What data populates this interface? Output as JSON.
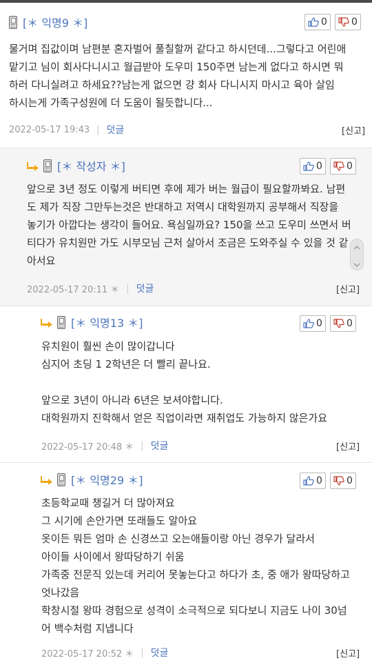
{
  "comments": [
    {
      "author": "[＊ 익명9 ＊]",
      "likes": "0",
      "dislikes": "0",
      "text": "물거며 집값이며 남편분 혼자벌어 풀칠할꺼 같다고 하시던데...그렇다고 어린애\n맡기고 님이 회사다니시고 월급받아 도우미 150주면 남는게 없다고 하시면 뭐\n하러 다니실려고 하세요??남는게 없으면 걍 회사 다니시지 마시고 육아 살임\n하시는게 가족구성원에 더 도움이 될듯합니다...",
      "date": "2022-05-17 19:43",
      "reply_label": "덧글",
      "report_label": "[신고]"
    },
    {
      "author": "[＊ 작성자 ＊]",
      "likes": "0",
      "dislikes": "0",
      "text": "앞으로 3년 정도 이렇게 버티면 후에 제가 버는 월급이 필요할까봐요. 남편\n도 제가 직장 그만두는것은 반대하고 저역시 대학원까지 공부해서 직장을\n놓기가 아깝다는 생각이 들어요. 욕심일까요? 150을 쓰고 도우미 쓰면서 버\n티다가 유치원만 가도 시부모님 근처 살아서 조금은 도와주실 수 있을 것 같\n아서요",
      "date": "2022-05-17 20:11 ＊",
      "reply_label": "덧글",
      "report_label": "[신고]"
    },
    {
      "author": "[＊ 익명13 ＊]",
      "likes": "0",
      "dislikes": "0",
      "text": "유치원이 훨씬 손이 많이갑니다\n심지어 초딩 1 2학년은 더 빨리 끝나요.\n\n앞으로 3년이 아니라 6년은 보셔야합니다.\n대학원까지 진학해서 얻은 직업이라면 재취업도 가능하지 않은가요",
      "date": "2022-05-17 20:48 ＊",
      "reply_label": "덧글",
      "report_label": "[신고]"
    },
    {
      "author": "[＊ 익명29 ＊]",
      "likes": "0",
      "dislikes": "0",
      "text": "초등학교때 챙길거 더 많아져요\n그 시기에 손안가면 또래들도 알아요\n옷이든 뭐든 엄마 손 신경쓰고 오는애들이랑 아닌 경우가 달라서\n아이들 사이에서 왕따당하기 쉬움\n가족중 전문직 있는데 커리어 못놓는다고 하다가 초, 중 애가 왕따당하고\n엇나갔음\n학창시절 왕따 경험으로 성격이 소극적으로 되다보니 지금도 나이 30넘\n어 백수처럼 지냅니다",
      "date": "2022-05-17 20:52 ＊",
      "reply_label": "덧글",
      "report_label": "[신고]"
    }
  ],
  "colors": {
    "author": "#4b74bd",
    "reply_bg": "#f5f5f5",
    "arrow": "#f0a818"
  },
  "icons": {
    "thumbs_up": "thumbs-up-icon",
    "thumbs_down": "thumbs-down-icon",
    "phone": "mobile-phone-icon",
    "reply_arrow": "reply-arrow-icon"
  }
}
